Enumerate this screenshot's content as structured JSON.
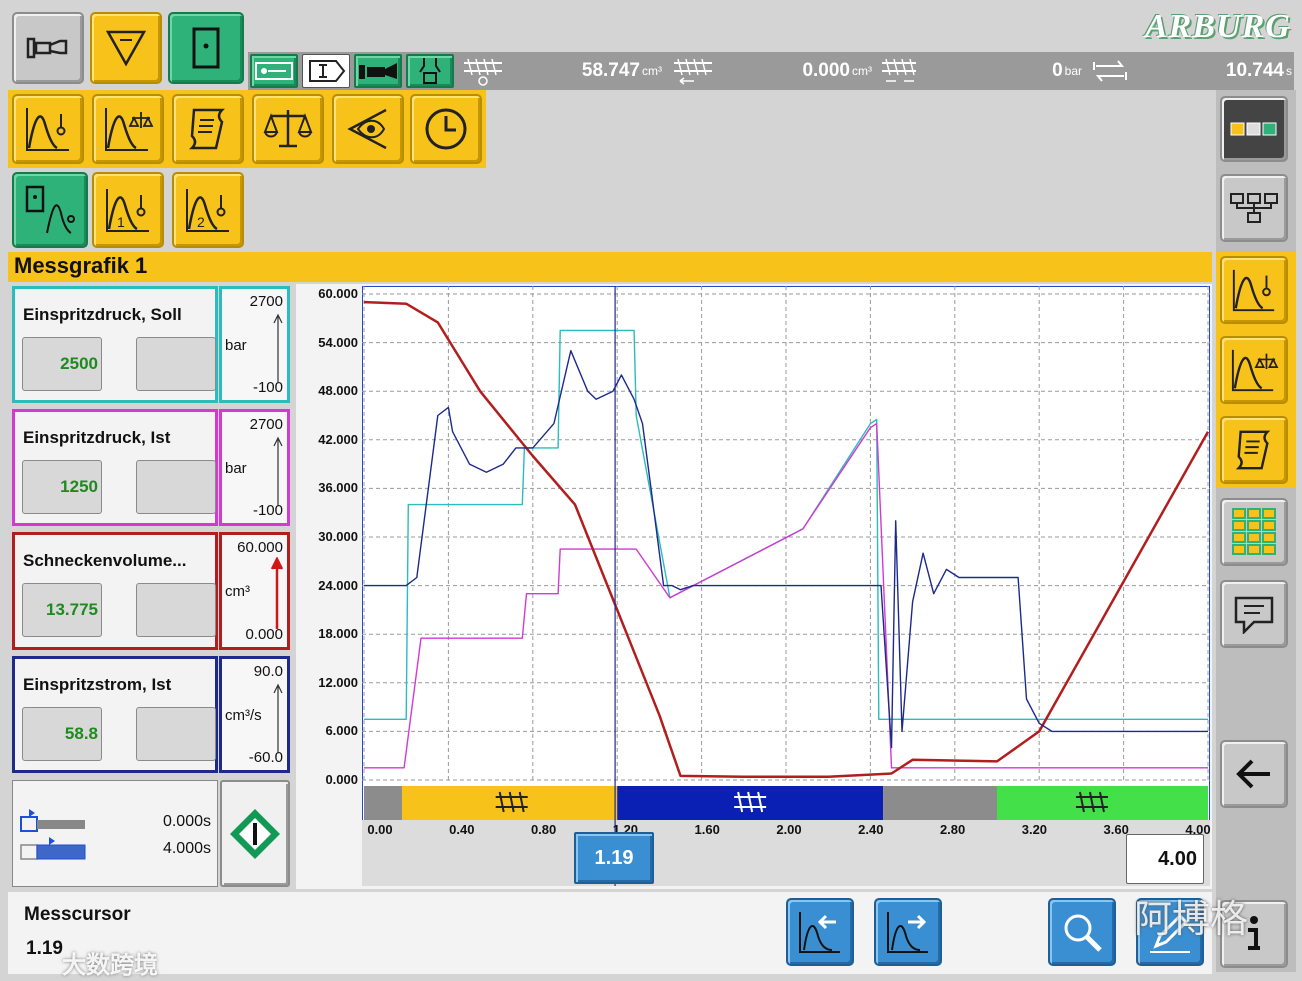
{
  "brand": "ARBURG",
  "status": {
    "screw_volume": "58.747",
    "screw_volume_unit": "cm³",
    "cushion": "0.000",
    "cushion_unit": "cm³",
    "pressure": "0",
    "pressure_unit": "bar",
    "cycle_time": "10.744",
    "cycle_time_unit": "s"
  },
  "page_title": "Messgrafik 1",
  "signals": [
    {
      "name": "Einspritzdruck, Soll",
      "value": "2500",
      "max": "2700",
      "unit": "bar",
      "min": "-100",
      "color": "#2bbcbc"
    },
    {
      "name": "Einspritzdruck, Ist",
      "value": "1250",
      "max": "2700",
      "unit": "bar",
      "min": "-100",
      "color": "#d23ad2"
    },
    {
      "name": "Schneckenvolume...",
      "value": "13.775",
      "max": "60.000",
      "unit": "cm³",
      "min": "0.000",
      "color": "#b21e1e"
    },
    {
      "name": "Einspritzstrom, Ist",
      "value": "58.8",
      "max": "90.0",
      "unit": "cm³/s",
      "min": "-60.0",
      "color": "#1e2a8a"
    }
  ],
  "time_window": {
    "start": "0.000s",
    "end": "4.000s"
  },
  "cursor": {
    "label": "Messcursor",
    "value": "1.19",
    "readout": "1.19",
    "end_value": "4.00"
  },
  "watermark": {
    "left": "大数跨境",
    "right": "阿博格"
  },
  "chart_data": {
    "type": "line",
    "xlim": [
      0,
      4
    ],
    "ylim": [
      0,
      60
    ],
    "y_ticks": [
      "60.000",
      "54.000",
      "48.000",
      "42.000",
      "36.000",
      "30.000",
      "24.000",
      "18.000",
      "12.000",
      "6.000",
      "0.000"
    ],
    "x_ticks": [
      "0.00",
      "0.40",
      "0.80",
      "1.20",
      "1.60",
      "2.00",
      "2.40",
      "2.80",
      "3.20",
      "3.60",
      "4.00"
    ],
    "grid": true,
    "cursor_x": 1.19,
    "phases": [
      {
        "from": 0.0,
        "to": 0.18,
        "color": "#8c8c8c"
      },
      {
        "from": 0.18,
        "to": 1.2,
        "color": "#f7c31b"
      },
      {
        "from": 1.2,
        "to": 2.46,
        "color": "#0a1fb4"
      },
      {
        "from": 2.46,
        "to": 3.0,
        "color": "#8c8c8c"
      },
      {
        "from": 3.0,
        "to": 4.0,
        "color": "#44e04a"
      }
    ],
    "series": [
      {
        "color": "#2bbcbc",
        "x": [
          0,
          0.2,
          0.21,
          0.75,
          0.76,
          0.92,
          0.93,
          1.28,
          1.29,
          1.45,
          2.08,
          2.4,
          2.43,
          2.44,
          4.0
        ],
        "y": [
          7.5,
          7.5,
          34,
          34,
          41,
          41,
          55.5,
          55.5,
          45,
          22.5,
          31,
          44,
          44.5,
          7.5,
          7.5
        ]
      },
      {
        "color": "#d23ad2",
        "x": [
          0,
          0.19,
          0.27,
          0.75,
          0.77,
          0.92,
          0.93,
          1.28,
          1.29,
          1.45,
          2.08,
          2.4,
          2.43,
          2.5,
          4.0
        ],
        "y": [
          1.5,
          1.5,
          17.5,
          17.5,
          23,
          23,
          28.5,
          28.5,
          28.5,
          22.5,
          31,
          43.5,
          44,
          1.5,
          1.5
        ]
      },
      {
        "color": "#b21e1e",
        "x": [
          0,
          0.2,
          0.35,
          0.55,
          0.8,
          1.0,
          1.2,
          1.4,
          1.5,
          1.8,
          2.2,
          2.5,
          2.6,
          3.0,
          3.2,
          4.0
        ],
        "y": [
          59,
          58.8,
          56.5,
          48,
          40,
          34,
          21,
          8,
          0.5,
          0.4,
          0.4,
          0.8,
          2.5,
          2.3,
          6,
          43
        ]
      },
      {
        "color": "#1e2a8a",
        "x": [
          0,
          0.2,
          0.25,
          0.3,
          0.35,
          0.4,
          0.42,
          0.5,
          0.58,
          0.66,
          0.72,
          0.8,
          0.9,
          0.98,
          1.06,
          1.1,
          1.18,
          1.22,
          1.28,
          1.32,
          1.36,
          1.42,
          1.46,
          1.5,
          1.56,
          1.6,
          2.2,
          2.45,
          2.5,
          2.52,
          2.55,
          2.6,
          2.65,
          2.7,
          2.76,
          2.82,
          2.9,
          3.1,
          3.14,
          3.2,
          3.26,
          3.34,
          3.5,
          3.7,
          3.9,
          4.0
        ],
        "y": [
          24,
          24,
          25,
          35,
          45,
          46,
          43,
          39,
          38,
          39,
          41,
          41,
          44,
          53,
          48,
          47,
          48,
          50,
          47,
          44,
          36,
          24,
          24,
          23.5,
          24,
          24,
          24,
          24,
          4,
          32,
          6,
          22,
          28,
          23,
          26,
          25,
          25,
          25,
          10,
          7,
          6,
          6,
          6,
          6,
          6,
          6
        ]
      }
    ]
  }
}
